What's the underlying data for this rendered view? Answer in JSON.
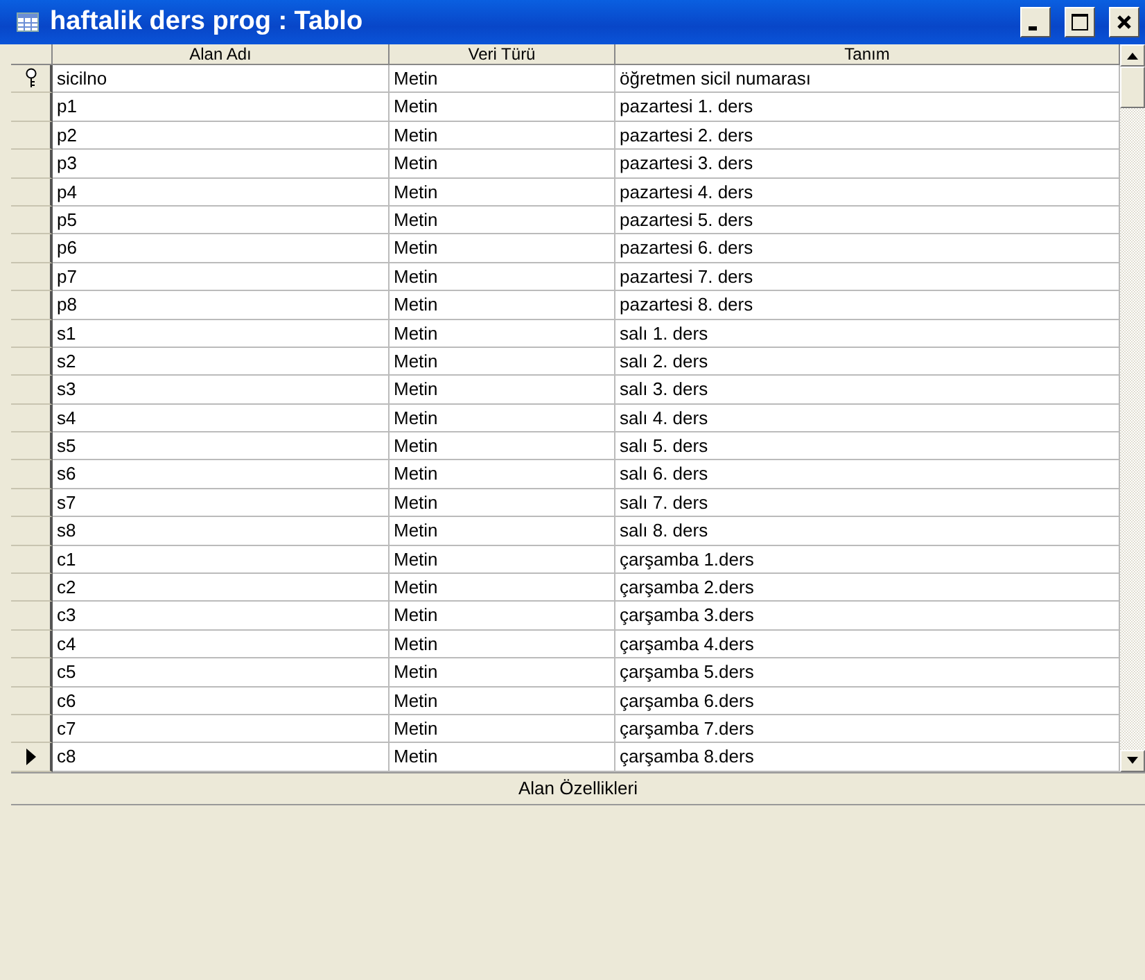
{
  "window": {
    "title": "haftalik ders prog : Tablo"
  },
  "table": {
    "columns": [
      "Alan Adı",
      "Veri Türü",
      "Tanım"
    ],
    "rows": [
      {
        "name": "sicilno",
        "type": "Metin",
        "description": "öğretmen sicil numarası",
        "primary_key": true,
        "selected": false
      },
      {
        "name": "p1",
        "type": "Metin",
        "description": "pazartesi 1. ders",
        "primary_key": false,
        "selected": false
      },
      {
        "name": "p2",
        "type": "Metin",
        "description": "pazartesi 2. ders",
        "primary_key": false,
        "selected": false
      },
      {
        "name": "p3",
        "type": "Metin",
        "description": "pazartesi 3. ders",
        "primary_key": false,
        "selected": false
      },
      {
        "name": "p4",
        "type": "Metin",
        "description": "pazartesi 4. ders",
        "primary_key": false,
        "selected": false
      },
      {
        "name": "p5",
        "type": "Metin",
        "description": "pazartesi 5. ders",
        "primary_key": false,
        "selected": false
      },
      {
        "name": "p6",
        "type": "Metin",
        "description": "pazartesi 6. ders",
        "primary_key": false,
        "selected": false
      },
      {
        "name": "p7",
        "type": "Metin",
        "description": "pazartesi 7. ders",
        "primary_key": false,
        "selected": false
      },
      {
        "name": "p8",
        "type": "Metin",
        "description": "pazartesi 8. ders",
        "primary_key": false,
        "selected": false
      },
      {
        "name": "s1",
        "type": "Metin",
        "description": "salı 1. ders",
        "primary_key": false,
        "selected": false
      },
      {
        "name": "s2",
        "type": "Metin",
        "description": "salı 2. ders",
        "primary_key": false,
        "selected": false
      },
      {
        "name": "s3",
        "type": "Metin",
        "description": "salı 3. ders",
        "primary_key": false,
        "selected": false
      },
      {
        "name": "s4",
        "type": "Metin",
        "description": "salı 4. ders",
        "primary_key": false,
        "selected": false
      },
      {
        "name": "s5",
        "type": "Metin",
        "description": "salı 5. ders",
        "primary_key": false,
        "selected": false
      },
      {
        "name": "s6",
        "type": "Metin",
        "description": "salı 6. ders",
        "primary_key": false,
        "selected": false
      },
      {
        "name": "s7",
        "type": "Metin",
        "description": "salı 7. ders",
        "primary_key": false,
        "selected": false
      },
      {
        "name": "s8",
        "type": "Metin",
        "description": "salı 8. ders",
        "primary_key": false,
        "selected": false
      },
      {
        "name": "c1",
        "type": "Metin",
        "description": "çarşamba 1.ders",
        "primary_key": false,
        "selected": false
      },
      {
        "name": "c2",
        "type": "Metin",
        "description": "çarşamba 2.ders",
        "primary_key": false,
        "selected": false
      },
      {
        "name": "c3",
        "type": "Metin",
        "description": "çarşamba 3.ders",
        "primary_key": false,
        "selected": false
      },
      {
        "name": "c4",
        "type": "Metin",
        "description": "çarşamba 4.ders",
        "primary_key": false,
        "selected": false
      },
      {
        "name": "c5",
        "type": "Metin",
        "description": "çarşamba 5.ders",
        "primary_key": false,
        "selected": false
      },
      {
        "name": "c6",
        "type": "Metin",
        "description": "çarşamba 6.ders",
        "primary_key": false,
        "selected": false
      },
      {
        "name": "c7",
        "type": "Metin",
        "description": "çarşamba 7.ders",
        "primary_key": false,
        "selected": false
      },
      {
        "name": "c8",
        "type": "Metin",
        "description": "çarşamba 8.ders",
        "primary_key": false,
        "selected": true
      }
    ]
  },
  "properties_bar": {
    "title": "Alan Özellikleri"
  }
}
